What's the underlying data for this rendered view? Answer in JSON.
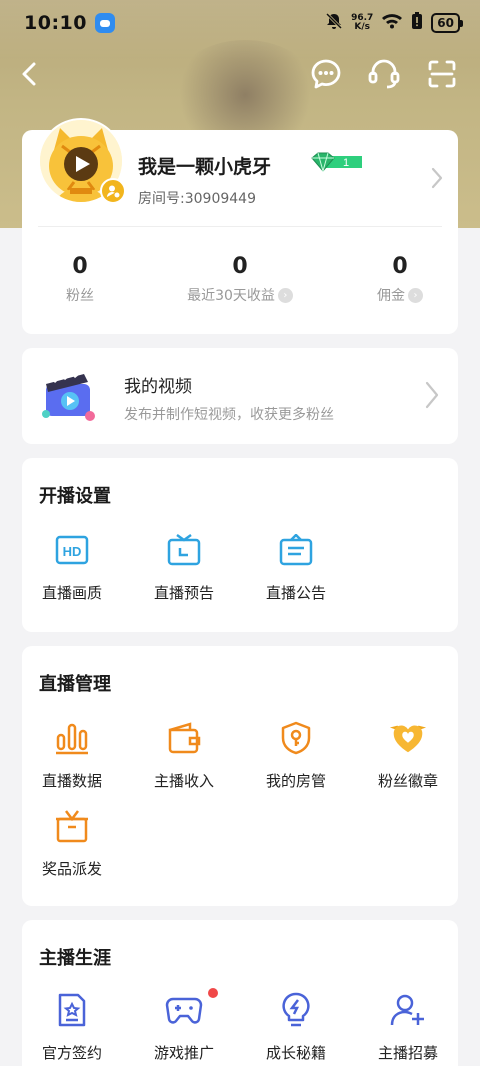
{
  "status_bar": {
    "time": "10:10",
    "net_speed_value": "96.7",
    "net_speed_unit": "K/s",
    "battery": "60"
  },
  "profile": {
    "nickname": "我是一颗小虎牙",
    "level": "1",
    "room_id": "房间号:30909449",
    "stats": [
      {
        "value": "0",
        "label": "粉丝"
      },
      {
        "value": "0",
        "label": "最近30天收益"
      },
      {
        "value": "0",
        "label": "佣金"
      }
    ]
  },
  "my_video": {
    "title": "我的视频",
    "subtitle": "发布并制作短视频，收获更多粉丝"
  },
  "live_settings": {
    "title": "开播设置",
    "items": [
      {
        "label": "直播画质",
        "icon": "hd-icon"
      },
      {
        "label": "直播预告",
        "icon": "tv-icon"
      },
      {
        "label": "直播公告",
        "icon": "notice-icon"
      }
    ]
  },
  "live_manage": {
    "title": "直播管理",
    "items": [
      {
        "label": "直播数据",
        "icon": "bar-chart-icon"
      },
      {
        "label": "主播收入",
        "icon": "wallet-icon"
      },
      {
        "label": "我的房管",
        "icon": "shield-key-icon"
      },
      {
        "label": "粉丝徽章",
        "icon": "heart-badge-icon"
      },
      {
        "label": "奖品派发",
        "icon": "gift-icon"
      }
    ]
  },
  "career": {
    "title": "主播生涯",
    "items": [
      {
        "label": "官方签约",
        "icon": "contract-icon"
      },
      {
        "label": "游戏推广",
        "icon": "gamepad-icon"
      },
      {
        "label": "成长秘籍",
        "icon": "bulb-icon"
      },
      {
        "label": "主播招募",
        "icon": "add-user-icon"
      }
    ]
  },
  "colors": {
    "blue_accent": "#2f8cf0",
    "orange_accent": "#f08a1c",
    "purple_accent": "#4a63d8",
    "red_dot": "#f04848"
  }
}
